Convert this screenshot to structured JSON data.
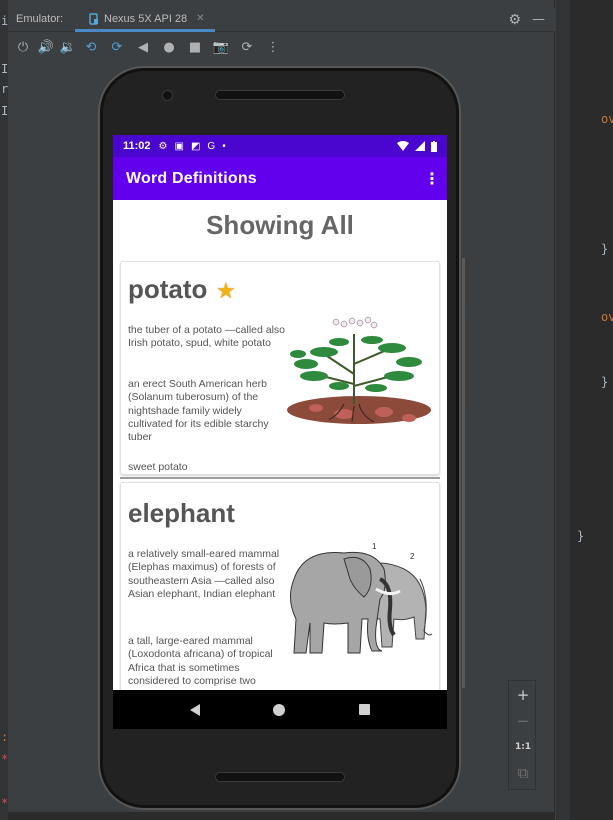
{
  "emulator": {
    "label": "Emulator:",
    "device_tab": "Nexus 5X API 28",
    "toolbar_icons": [
      "power-icon",
      "volume-up-icon",
      "volume-down-icon",
      "rotate-left-icon",
      "rotate-right-icon",
      "back-icon",
      "home-icon",
      "overview-icon",
      "screenshot-icon",
      "snapshot-icon",
      "more-icon"
    ],
    "side_controls": {
      "zoom_in": "+",
      "zoom_out": "−",
      "one_to_one": "1:1"
    }
  },
  "ide": {
    "left_chars": [
      "i",
      "I",
      "r",
      "I",
      ":",
      "*",
      "*"
    ],
    "right_snippets": [
      "ov",
      "ov",
      "}",
      "}",
      "}"
    ]
  },
  "phone": {
    "status": {
      "time": "11:02"
    },
    "app_title": "Word Definitions",
    "heading": "Showing All",
    "entries": [
      {
        "word": "potato",
        "favorite": true,
        "definitions": [
          "the tuber of a potato —called also Irish potato, spud, white potato",
          "an erect South American herb (Solanum tuberosum) of the nightshade family widely cultivated for its edible starchy tuber",
          "sweet potato"
        ]
      },
      {
        "word": "elephant",
        "favorite": false,
        "definitions": [
          "a relatively small-eared mammal (Elephas maximus) of forests of southeastern Asia —called also Asian elephant, Indian elephant",
          "a tall, large-eared mammal (Loxodonta africana) of tropical Africa that is sometimes considered to comprise two separate"
        ],
        "image_labels": [
          "1",
          "2"
        ]
      }
    ]
  },
  "colors": {
    "app_bar": "#6200ee",
    "status_bar": "#4a06cf",
    "star": "#f3b21a"
  }
}
